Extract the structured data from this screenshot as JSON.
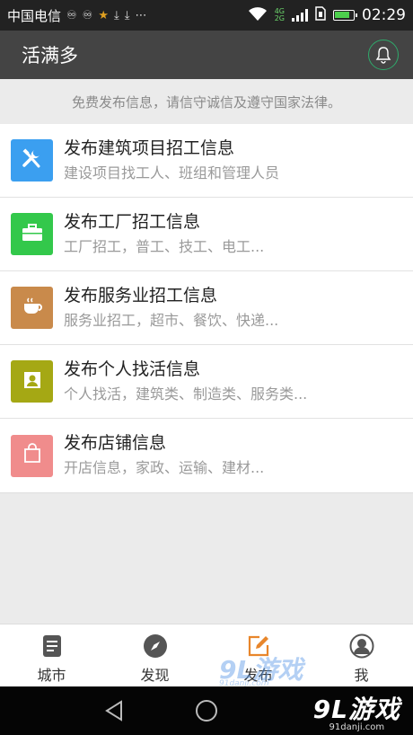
{
  "status_bar": {
    "carrier": "中国电信",
    "network_top": "4G",
    "network_bottom": "2G",
    "time": "02:29"
  },
  "app_bar": {
    "title": "活满多",
    "bell_icon": "bell-icon"
  },
  "notice": "免费发布信息，请信守诚信及遵守国家法律。",
  "items": [
    {
      "title": "发布建筑项目招工信息",
      "subtitle": "建设项目找工人、班组和管理人员",
      "icon": "tools-icon",
      "color": "#3b9ff0"
    },
    {
      "title": "发布工厂招工信息",
      "subtitle": "工厂招工，普工、技工、电工...",
      "icon": "briefcase-icon",
      "color": "#33c84b"
    },
    {
      "title": "发布服务业招工信息",
      "subtitle": "服务业招工，超市、餐饮、快递...",
      "icon": "coffee-cup-icon",
      "color": "#c98a4b"
    },
    {
      "title": "发布个人找活信息",
      "subtitle": "个人找活，建筑类、制造类、服务类...",
      "icon": "person-icon",
      "color": "#a5a814"
    },
    {
      "title": "发布店铺信息",
      "subtitle": "开店信息，家政、运输、建材...",
      "icon": "shopping-bag-icon",
      "color": "#f08c8c"
    }
  ],
  "tabs": [
    {
      "label": "城市",
      "icon": "document-icon"
    },
    {
      "label": "发现",
      "icon": "compass-icon"
    },
    {
      "label": "发布",
      "icon": "edit-icon",
      "active": true
    },
    {
      "label": "我",
      "icon": "user-icon"
    }
  ],
  "watermark": {
    "logo": "9L游戏",
    "url": "91danji.com"
  },
  "brand": {
    "logo": "9L游戏",
    "url": "91danji.com"
  },
  "colors": {
    "accent": "#e8862b",
    "bell_ring": "#2fa96b",
    "app_bar": "#444444"
  }
}
